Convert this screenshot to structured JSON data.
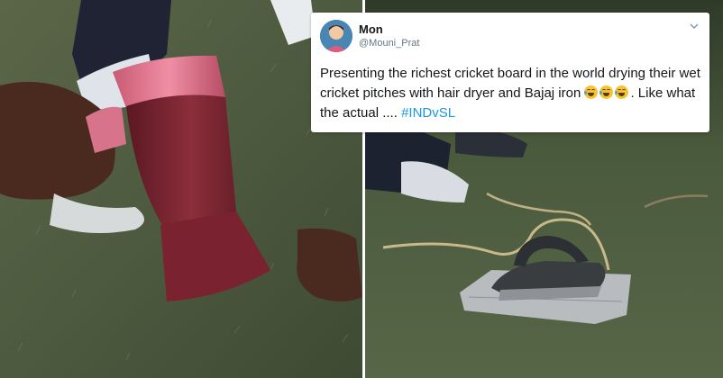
{
  "tweet": {
    "display_name": "Mon",
    "handle": "@Mouni_Prat",
    "text_main": "Presenting the richest cricket board in the world drying their wet cricket pitches with hair dryer and Bajaj iron",
    "text_after_emoji": ". Like what the actual ....",
    "hashtag": "#INDvSL",
    "emoji_count": 3,
    "menu_icon": "chevron-down-icon"
  },
  "photos": {
    "left": "hair-dryer-photo",
    "right": "clothes-iron-photo"
  },
  "colors": {
    "hashtag": "#1b95e0",
    "text": "#14171a",
    "secondary": "#657786",
    "dryer_pink": "#e2788e",
    "dryer_maroon": "#6e1f2a"
  }
}
